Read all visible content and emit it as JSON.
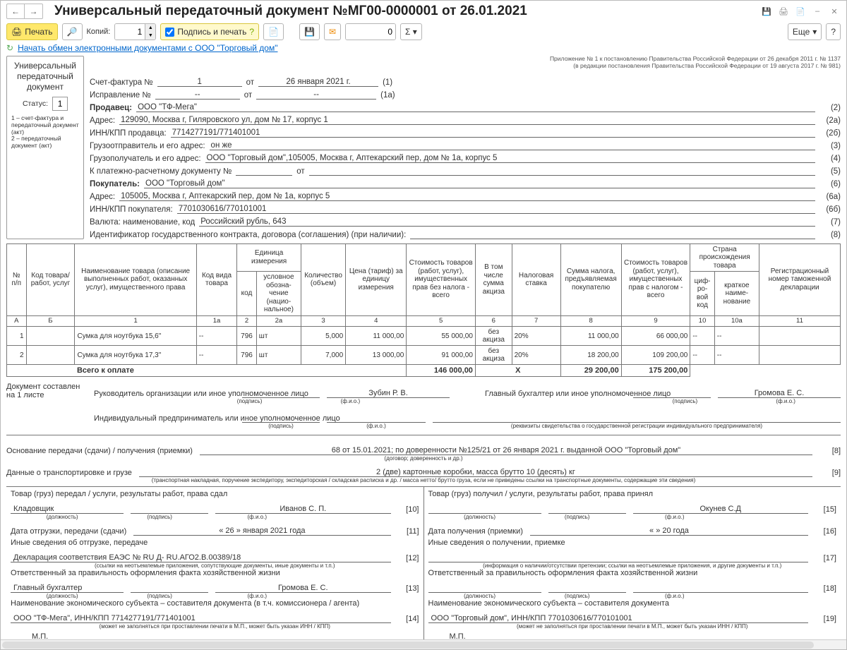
{
  "title": "Универсальный передаточный документ №МГ00-0000001 от 26.01.2021",
  "toolbar": {
    "print": "Печать",
    "copies_label": "Копий:",
    "copies_value": "1",
    "sign_print": "Подпись и печать",
    "zero": "0",
    "more": "Еще"
  },
  "refresh_link": "Начать обмен электронными документами с ООО \"Торговый дом\"",
  "status": {
    "title_l1": "Универсальный передаточный документ",
    "label": "Статус:",
    "value": "1",
    "note": "1 – счет-фактура и передаточный документ (акт)\n2 – передаточный документ (акт)"
  },
  "header": {
    "app_note_l1": "Приложение № 1 к постановлению Правительства Российской Федерации от 26 декабря 2011 г. № 1137",
    "app_note_l2": "(в редакции постановления Правительства Российской Федерации от 19 августа 2017 г. № 981)",
    "sf_label": "Счет-фактура №",
    "sf_no": "1",
    "sf_ot": "от",
    "sf_date": "26 января 2021 г.",
    "sf_r": "(1)",
    "isp_label": "Исправление №",
    "isp_no": "--",
    "isp_date": "--",
    "isp_r": "(1а)",
    "seller_label": "Продавец:",
    "seller": "ООО \"ТФ-Мега\"",
    "seller_r": "(2)",
    "addr_label": "Адрес:",
    "addr": "129090, Москва г, Гиляровского ул, дом № 17, корпус 1",
    "addr_r": "(2а)",
    "inn_label": "ИНН/КПП продавца:",
    "inn": "7714277191/771401001",
    "inn_r": "(2б)",
    "sender_label": "Грузоотправитель и его адрес:",
    "sender": "он же",
    "sender_r": "(3)",
    "recv_label": "Грузополучатель и его адрес:",
    "recv": "ООО \"Торговый дом\",105005, Москва г, Аптекарский пер, дом № 1а, корпус 5",
    "recv_r": "(4)",
    "paydoc_label": "К платежно-расчетному документу №",
    "paydoc_ot": "от",
    "paydoc_r": "(5)",
    "buyer_label": "Покупатель:",
    "buyer": "ООО \"Торговый дом\"",
    "buyer_r": "(6)",
    "baddr_label": "Адрес:",
    "baddr": "105005, Москва г, Аптекарский пер, дом № 1а, корпус 5",
    "baddr_r": "(6а)",
    "binn_label": "ИНН/КПП покупателя:",
    "binn": "7701030616/770101001",
    "binn_r": "(6б)",
    "cur_label": "Валюта: наименование, код",
    "cur": "Российский рубль, 643",
    "cur_r": "(7)",
    "gov_label": "Идентификатор государственного контракта, договора (соглашения) (при наличии):",
    "gov_r": "(8)"
  },
  "table": {
    "h_np": "№ п/п",
    "h_code": "Код товара/ работ, услуг",
    "h_name": "Наименование товара (описание выполненных работ, оказанных услуг), имущественного права",
    "h_kind": "Код вида товара",
    "h_unit": "Единица измерения",
    "h_unit_code": "код",
    "h_unit_name": "условное обозна­чение (нацио­нальное)",
    "h_qty": "Коли­чество (объем)",
    "h_price": "Цена (тариф) за единицу измерения",
    "h_cost": "Стоимость товаров (работ, услуг), имущест­венных прав без налога - всего",
    "h_excise": "В том числе сумма акциза",
    "h_rate": "Налоговая ставка",
    "h_tax": "Сумма налога, предъяв­ляемая покупателю",
    "h_total": "Стоимость товаров (работ, услуг), имущест­венных прав с налогом - всего",
    "h_country": "Страна происхождения товара",
    "h_country_code": "циф­ро­вой код",
    "h_country_name": "краткое наиме­нование",
    "h_decl": "Регистрационный номер таможенной декларации",
    "cA": "А",
    "cB": "Б",
    "c1": "1",
    "c1a": "1а",
    "c2": "2",
    "c2a": "2а",
    "c3": "3",
    "c4": "4",
    "c5": "5",
    "c6": "6",
    "c7": "7",
    "c8": "8",
    "c9": "9",
    "c10": "10",
    "c10a": "10а",
    "c11": "11",
    "rows": [
      {
        "n": "1",
        "name": "Сумка для ноутбука 15,6\"",
        "kind": "--",
        "ucode": "796",
        "uname": "шт",
        "qty": "5,000",
        "price": "11 000,00",
        "cost": "55 000,00",
        "exc": "без акциза",
        "rate": "20%",
        "tax": "11 000,00",
        "total": "66 000,00",
        "cc": "--",
        "cn": "--",
        "decl": ""
      },
      {
        "n": "2",
        "name": "Сумка для ноутбука 17,3\"",
        "kind": "--",
        "ucode": "796",
        "uname": "шт",
        "qty": "7,000",
        "price": "13 000,00",
        "cost": "91 000,00",
        "exc": "без акциза",
        "rate": "20%",
        "tax": "18 200,00",
        "total": "109 200,00",
        "cc": "--",
        "cn": "--",
        "decl": ""
      }
    ],
    "total_label": "Всего к оплате",
    "total_cost": "146 000,00",
    "total_x": "Х",
    "total_tax": "29 200,00",
    "total_sum": "175 200,00"
  },
  "sig": {
    "doc_on": "Документ составлен на 1 листе",
    "head_lbl": "Руководитель организации или иное уполномоченное лицо",
    "head_name": "Зубин Р. В.",
    "acc_lbl": "Главный бухгалтер или иное уполномоченное лицо",
    "acc_name": "Громова Е. С.",
    "ip_lbl": "Индивидуальный предприниматель или иное уполномоченное лицо",
    "cap_sign": "(подпись)",
    "cap_fio": "(ф.и.о.)",
    "cap_rekv": "(реквизиты свидетельства о государственной регистрации индивидуального предпринимателя)",
    "basis_lbl": "Основание передачи (сдачи) / получения (приемки)",
    "basis_val": "68 от 15.01.2021; по доверенности №125/21 от 26 января 2021 г. выданной ООО \"Торговый дом\"",
    "basis_cap": "(договор; доверенность и др.)",
    "basis_r": "[8]",
    "trans_lbl": "Данные о транспортировке и грузе",
    "trans_val": "2 (две) картонные коробки, масса брутто 10 (десять) кг",
    "trans_cap": "(транспортная накладная, поручение экспедитору, экспедиторская / складская расписка и др. / масса нетто/ брутто груза, если не приведены ссылки на транспортные документы, содержащие эти сведения)",
    "trans_r": "[9]",
    "left_title": "Товар (груз) передал / услуги, результаты работ, права сдал",
    "left_pos": "Кладовщик",
    "left_person": "Иванов С. П.",
    "left_r1": "[10]",
    "left_date_lbl": "Дата отгрузки, передачи (сдачи)",
    "left_date_val": "« 26 »   января   2021   года",
    "left_r2": "[11]",
    "left_other_lbl": "Иные сведения об отгрузке, передаче",
    "left_other_val": "Декларация соответствия ЕАЭС № RU Д- RU.АГО2.В.00389/18",
    "left_other_cap": "(ссылки на неотъемлемые приложения, сопутствующие документы, иные документы и т.п.)",
    "left_r3": "[12]",
    "left_resp_lbl": "Ответственный за правильность оформления факта хозяйственной жизни",
    "left_resp_pos": "Главный бухгалтер",
    "left_resp_name": "Громова Е. С.",
    "left_r4": "[13]",
    "left_org_lbl": "Наименование экономического субъекта – составителя документа (в т.ч. комиссионера / агента)",
    "left_org_val": "ООО \"ТФ-Мега\", ИНН/КПП 7714277191/771401001",
    "left_org_cap": "(может не заполняться при проставлении печати в М.П., может быть указан ИНН / КПП)",
    "left_r5": "[14]",
    "right_title": "Товар (груз) получил / услуги, результаты работ, права принял",
    "right_person": "Окунев С.Д",
    "right_r1": "[15]",
    "right_date_lbl": "Дата получения (приемки)",
    "right_date_val": "«      »                          20       года",
    "right_r2": "[16]",
    "right_other_lbl": "Иные сведения о получении, приемке",
    "right_other_cap": "(информация о наличии/отсутствии претензии; ссылки на неотъемлемые приложения, и другие документы и т.п.)",
    "right_r3": "[17]",
    "right_resp_lbl": "Ответственный за правильность оформления факта хозяйственной жизни",
    "right_r4": "[18]",
    "right_org_lbl": "Наименование экономического субъекта – составителя документа",
    "right_org_val": "ООО \"Торговый дом\", ИНН/КПП 7701030616/770101001",
    "right_org_cap": "(может не заполняться при проставлении печати в М.П., может быть указан ИНН / КПП)",
    "right_r5": "[19]",
    "cap_pos": "(должность)",
    "mp": "М.П."
  }
}
